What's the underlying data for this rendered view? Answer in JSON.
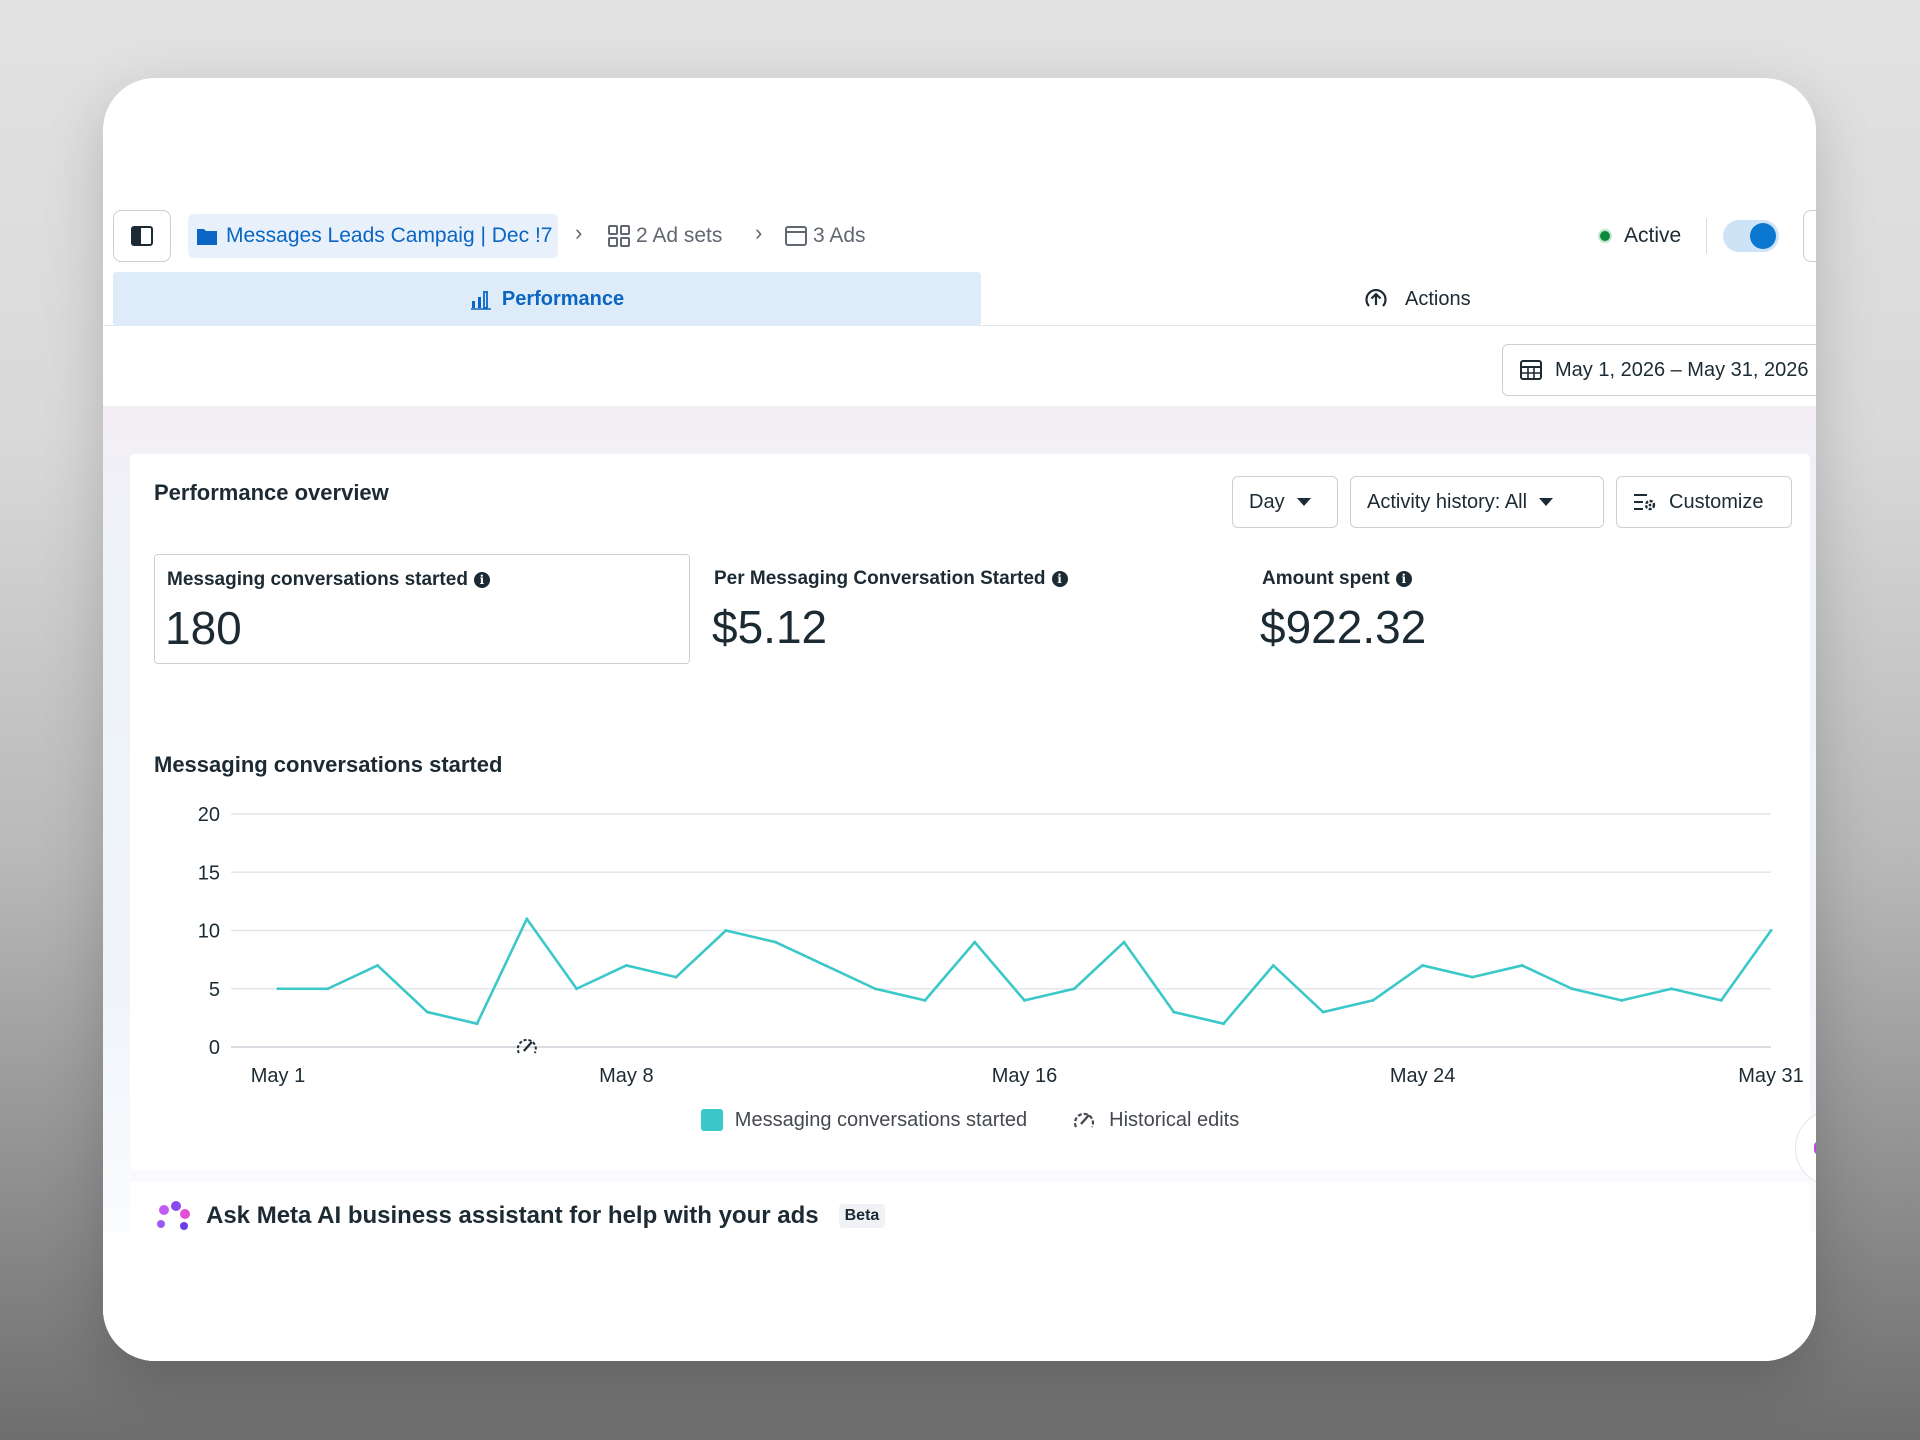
{
  "breadcrumb": {
    "campaign": "Messages Leads Campaig | Dec !7",
    "adsets": "2 Ad sets",
    "ads": "3 Ads"
  },
  "status": {
    "label": "Active",
    "toggle_on": true,
    "dot_color": "#0b8a3e"
  },
  "tabs": [
    {
      "label": "Performance",
      "selected": true
    },
    {
      "label": "Actions",
      "selected": false
    }
  ],
  "date_range": "May 1, 2026 – May 31, 2026",
  "overview": {
    "title": "Performance overview",
    "granularity": "Day",
    "activity_history": "Activity history: All",
    "customize": "Customize",
    "metrics": [
      {
        "label": "Messaging conversations started",
        "value": "180",
        "selected": true
      },
      {
        "label": "Per Messaging Conversation Started",
        "value": "$5.12",
        "selected": false
      },
      {
        "label": "Amount spent",
        "value": "$922.32",
        "selected": false
      }
    ]
  },
  "chart_data": {
    "type": "line",
    "title": "Messaging conversations started",
    "x": [
      "May 1",
      "May 2",
      "May 3",
      "May 4",
      "May 5",
      "May 6",
      "May 7",
      "May 8",
      "May 9",
      "May 10",
      "May 11",
      "May 12",
      "May 13",
      "May 14",
      "May 15",
      "May 16",
      "May 17",
      "May 18",
      "May 19",
      "May 20",
      "May 21",
      "May 22",
      "May 23",
      "May 24",
      "May 25",
      "May 26",
      "May 27",
      "May 28",
      "May 29",
      "May 30",
      "May 31"
    ],
    "series": [
      {
        "name": "Messaging conversations started",
        "color": "#3cc8c8",
        "values": [
          5,
          5,
          7,
          3,
          2,
          11,
          5,
          7,
          6,
          10,
          9,
          7,
          5,
          4,
          9,
          4,
          5,
          9,
          3,
          2,
          7,
          3,
          4,
          7,
          6,
          7,
          5,
          4,
          5,
          4,
          10
        ]
      }
    ],
    "x_tick_labels": [
      "May 1",
      "May 8",
      "May 16",
      "May 24",
      "May 31"
    ],
    "y_ticks": [
      0,
      5,
      10,
      15,
      20
    ],
    "ylim": [
      0,
      20
    ],
    "grid": true,
    "historical_edit_markers": [
      "May 6"
    ],
    "legend": [
      "Messaging conversations started",
      "Historical edits"
    ]
  },
  "assistant": {
    "title": "Ask Meta AI business assistant for help with your ads",
    "badge": "Beta"
  }
}
